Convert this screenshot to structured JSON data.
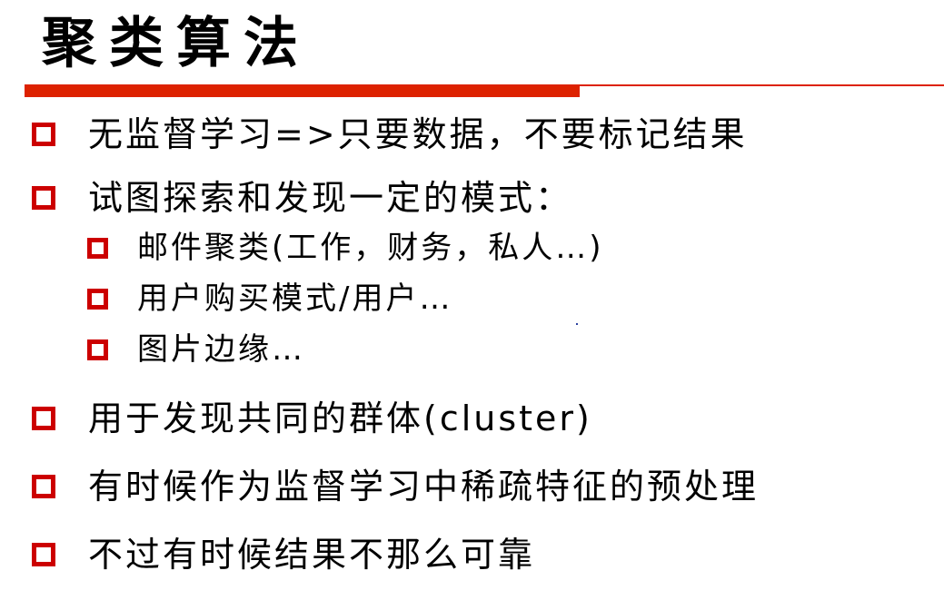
{
  "slide": {
    "title": "聚类算法"
  },
  "colors": {
    "bullet_box": "#cc0000",
    "rule": "#dd2200",
    "title_text": "#000000",
    "body_text": "#000000"
  },
  "bullets": [
    {
      "level": 1,
      "text": "无监督学习=>只要数据，不要标记结果"
    },
    {
      "level": 1,
      "text": "试图探索和发现一定的模式："
    },
    {
      "level": 2,
      "text": "邮件聚类(工作，财务，私人…)"
    },
    {
      "level": 2,
      "text": "用户购买模式/用户…"
    },
    {
      "level": 2,
      "text": "图片边缘…"
    },
    {
      "level": 1,
      "text": "用于发现共同的群体(cluster)"
    },
    {
      "level": 1,
      "text": "有时候作为监督学习中稀疏特征的预处理"
    },
    {
      "level": 1,
      "text": "不过有时候结果不那么可靠"
    }
  ]
}
